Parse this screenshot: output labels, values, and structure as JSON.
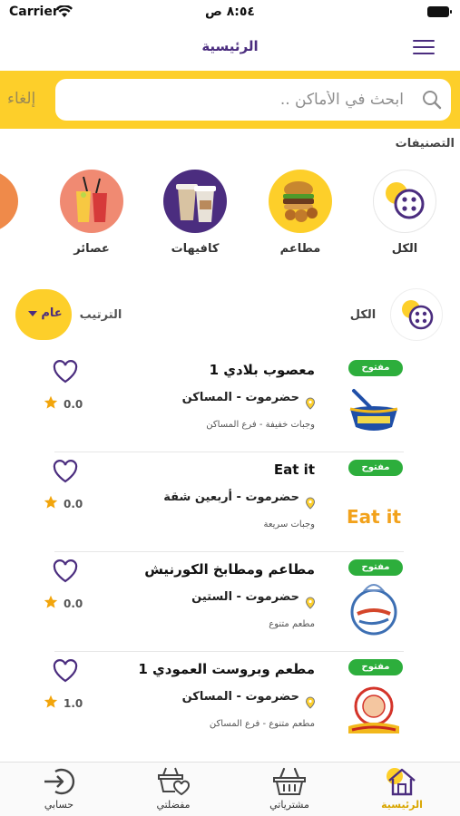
{
  "status_bar": {
    "carrier": "Carrier",
    "time": "٨:٥٤ ص"
  },
  "header": {
    "title": "الرئيسية"
  },
  "search": {
    "placeholder": "ابحث في الأماكن ..",
    "cancel_label": "إلغاء"
  },
  "categories": {
    "title": "التصنيفات",
    "items": [
      {
        "label": "الكل",
        "icon": "all-categories-icon"
      },
      {
        "label": "مطاعم",
        "icon": "burger-food-image"
      },
      {
        "label": "كافيهات",
        "icon": "coffee-cups-image"
      },
      {
        "label": "عصائر",
        "icon": "juice-glasses-image"
      }
    ]
  },
  "filter": {
    "current_category": "الكل",
    "sort_label": "الترتيب",
    "sort_value": "عام"
  },
  "listings": [
    {
      "name": "معصوب بلادي 1",
      "location": "حضرموت - المساكن",
      "category": "وجبات خفيفة - فرع المساكن",
      "status": "مفتوح",
      "rating": "0.0",
      "logo": "balady-bowl-logo"
    },
    {
      "name": "Eat it",
      "location": "حضرموت - أربعين شقة",
      "category": "وجبات سريعة",
      "status": "مفتوح",
      "rating": "0.0",
      "logo": "eat-it-logo"
    },
    {
      "name": "مطاعم ومطابخ الكورنيش",
      "location": "حضرموت - الستين",
      "category": "مطعم متنوع",
      "status": "مفتوح",
      "rating": "0.0",
      "logo": "corniche-logo"
    },
    {
      "name": "مطعم وبروست العمودي 1",
      "location": "حضرموت - المساكن",
      "category": "مطعم متنوع - فرع المساكن",
      "status": "مفتوح",
      "rating": "1.0",
      "logo": "alamoudi-broast-logo"
    }
  ],
  "bottom_nav": {
    "items": [
      {
        "label": "الرئيسية",
        "icon": "home-icon",
        "active": true
      },
      {
        "label": "مشترياتي",
        "icon": "basket-icon",
        "active": false
      },
      {
        "label": "مفضلتي",
        "icon": "favorite-basket-icon",
        "active": false
      },
      {
        "label": "حسابي",
        "icon": "login-icon",
        "active": false
      }
    ]
  },
  "colors": {
    "accent": "#fdcf2a",
    "brand_purple": "#4b2d7f",
    "open_green": "#2dae3c",
    "star": "#f2a50c"
  }
}
